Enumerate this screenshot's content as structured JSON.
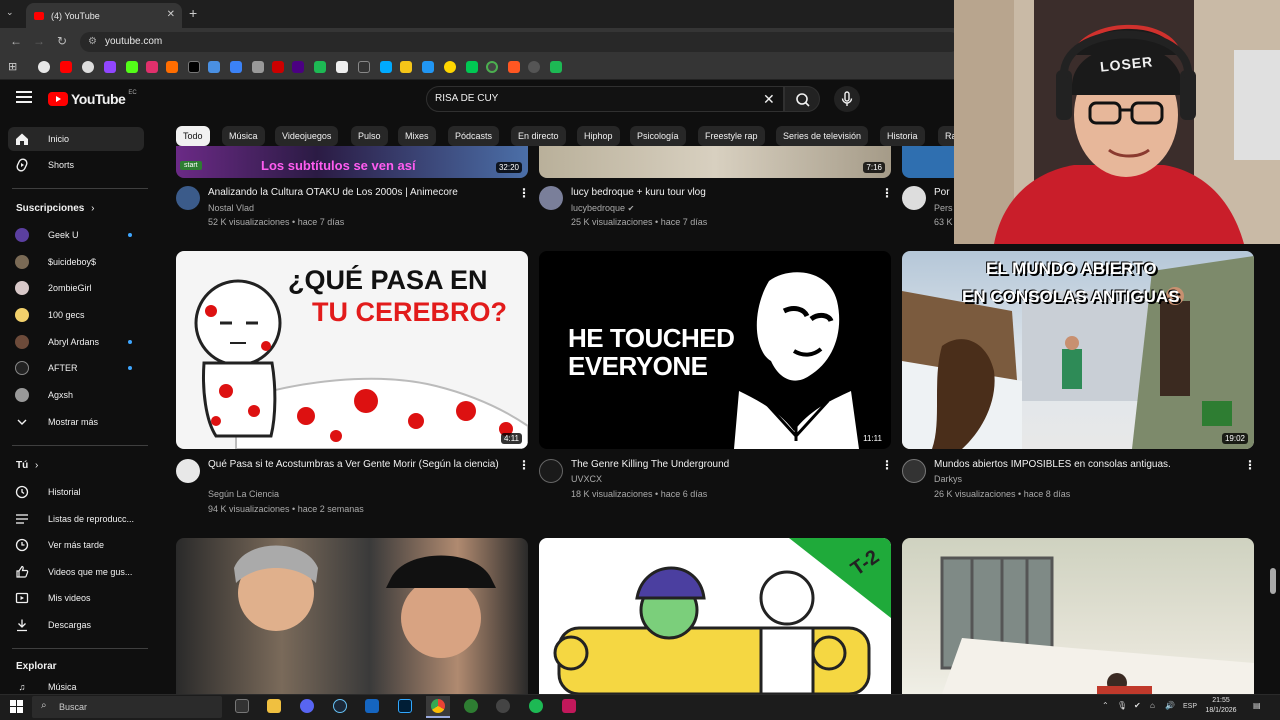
{
  "browser": {
    "tab_title": "(4) YouTube",
    "url": "youtube.com"
  },
  "masthead": {
    "logo_text": "YouTube",
    "country_code": "EC",
    "search_value": "RISA DE CUY"
  },
  "sidebar": {
    "main": [
      {
        "label": "Inicio",
        "icon": "home-icon",
        "active": true
      },
      {
        "label": "Shorts",
        "icon": "shorts-icon"
      }
    ],
    "subs_header": "Suscripciones",
    "subscriptions": [
      {
        "label": "Geek U",
        "dot": true
      },
      {
        "label": "$uicideboy$",
        "dot": false
      },
      {
        "label": "2ombieGirl",
        "dot": false
      },
      {
        "label": "100 gecs",
        "dot": false
      },
      {
        "label": "Abryl Ardans",
        "dot": true
      },
      {
        "label": "AFTER",
        "dot": true
      },
      {
        "label": "Agxsh",
        "dot": false
      }
    ],
    "show_more": "Mostrar más",
    "you_header": "Tú",
    "you_items": [
      {
        "label": "Historial",
        "icon": "history-icon"
      },
      {
        "label": "Listas de reproducc...",
        "icon": "playlist-icon"
      },
      {
        "label": "Ver más tarde",
        "icon": "watch-later-icon"
      },
      {
        "label": "Videos que me gus...",
        "icon": "like-icon"
      },
      {
        "label": "Mis videos",
        "icon": "my-videos-icon"
      },
      {
        "label": "Descargas",
        "icon": "download-icon"
      }
    ],
    "explore_header": "Explorar",
    "explore_items": [
      {
        "label": "Música",
        "icon": "music-icon"
      }
    ]
  },
  "chips": [
    "Todo",
    "Música",
    "Videojuegos",
    "Pulso",
    "Mixes",
    "Pódcasts",
    "En directo",
    "Hiphop",
    "Psicología",
    "Freestyle rap",
    "Series de televisión",
    "Historia",
    "Ra"
  ],
  "videos_row1": [
    {
      "title": "Analizando la Cultura OTAKU de Los 2000s | Animecore",
      "channel": "Nostal Vlad",
      "views": "52 K visualizaciones",
      "age": "hace 7 días",
      "duration": "32:20",
      "thumb_caption": "Los subtítulos se ven así",
      "thumb_tag": "start"
    },
    {
      "title": "lucy bedroque + kuru tour vlog",
      "channel": "lucybedroque",
      "views": "25 K visualizaciones",
      "age": "hace 7 días",
      "duration": "7:16",
      "verified": true
    },
    {
      "title": "Por",
      "channel": "Pers",
      "views": "63 K"
    }
  ],
  "videos_row2": [
    {
      "title": "Qué Pasa si te Acostumbras a Ver Gente Morir (Según la ciencia)",
      "channel": "Según La Ciencia",
      "views": "94 K visualizaciones",
      "age": "hace 2 semanas",
      "duration": "4:11",
      "thumb_line1": "¿QUÉ PASA EN",
      "thumb_line2": "TU CEREBRO?"
    },
    {
      "title": "The Genre Killing The Underground",
      "channel": "UVXCX",
      "views": "18 K visualizaciones",
      "age": "hace 6 días",
      "duration": "11:11",
      "thumb_line1": "HE TOUCHED",
      "thumb_line2": "EVERYONE"
    },
    {
      "title": "Mundos abiertos IMPOSIBLES en consolas antiguas.",
      "channel": "Darkys",
      "views": "26 K visualizaciones",
      "age": "hace 8 días",
      "duration": "19:02",
      "thumb_line1": "EL MUNDO ABIERTO",
      "thumb_line2": "EN CONSOLAS ANTIGUAS"
    }
  ],
  "row3_thumb_badge": "T-2",
  "webcam": {
    "cap_text": "LOSER"
  },
  "taskbar": {
    "search_placeholder": "Buscar",
    "lang": "ESP",
    "time": "21:55",
    "date": "18/1/2026"
  },
  "colors": {
    "accent": "#ff0000",
    "link": "#3ea6ff",
    "chip_selected": "#f1f1f1"
  }
}
